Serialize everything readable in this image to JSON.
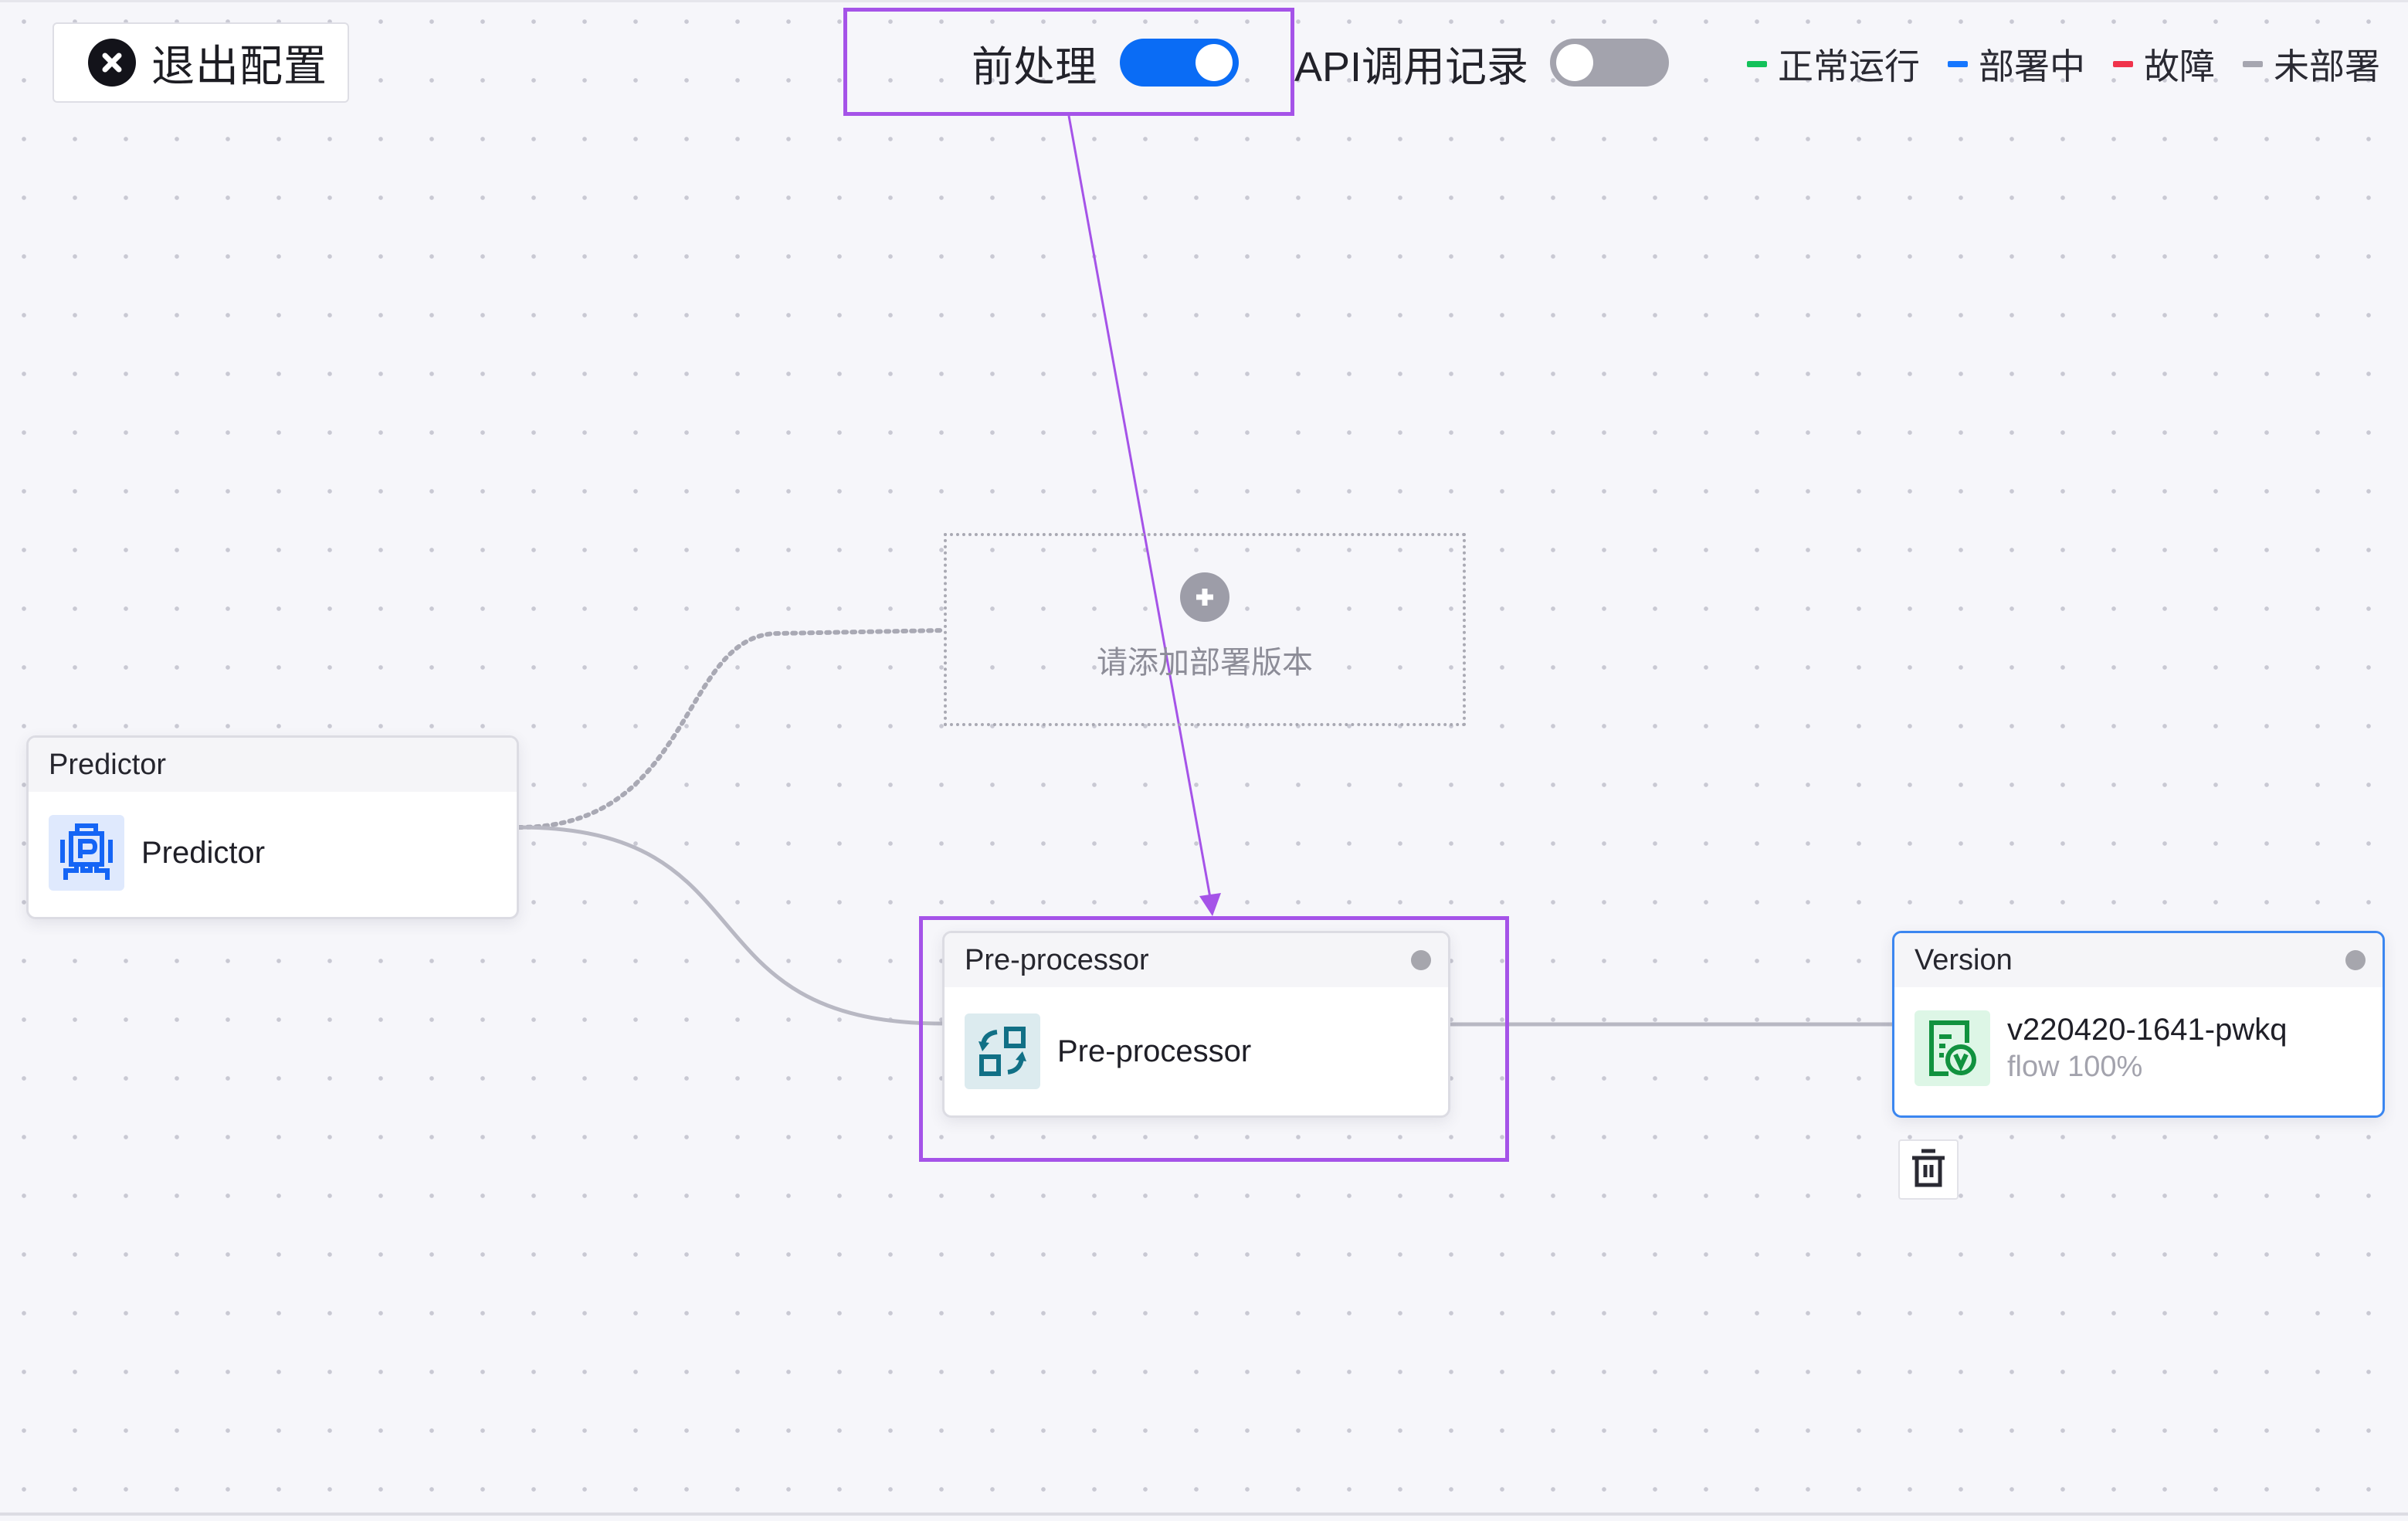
{
  "toolbar": {
    "exit_button": {
      "label": "退出配置",
      "icon": "close-circle-icon"
    },
    "toggles": [
      {
        "label": "前处理",
        "state": "on"
      },
      {
        "label": "API调用记录",
        "state": "off"
      }
    ]
  },
  "legend": {
    "items": [
      {
        "label": "正常运行",
        "color": "#13c15a"
      },
      {
        "label": "部署中",
        "color": "#1677ff"
      },
      {
        "label": "故障",
        "color": "#f0334b"
      },
      {
        "label": "未部署",
        "color": "#a6a6b0"
      }
    ]
  },
  "canvas": {
    "nodes": {
      "predictor": {
        "header": "Predictor",
        "name": "Predictor",
        "icon": "predictor-icon"
      },
      "preprocessor": {
        "header": "Pre-processor",
        "name": "Pre-processor",
        "icon": "preprocessor-icon",
        "status": "not-deployed"
      },
      "version": {
        "header": "Version",
        "name": "v220420-1641-pwkq",
        "flow": "flow 100%",
        "icon": "version-icon",
        "status": "not-deployed"
      }
    },
    "placeholder": {
      "text": "请添加部署版本",
      "icon": "plus-circle-icon"
    },
    "delete_button": {
      "icon": "trash-icon"
    }
  },
  "annotations": {
    "highlight_color": "#a553e8"
  }
}
